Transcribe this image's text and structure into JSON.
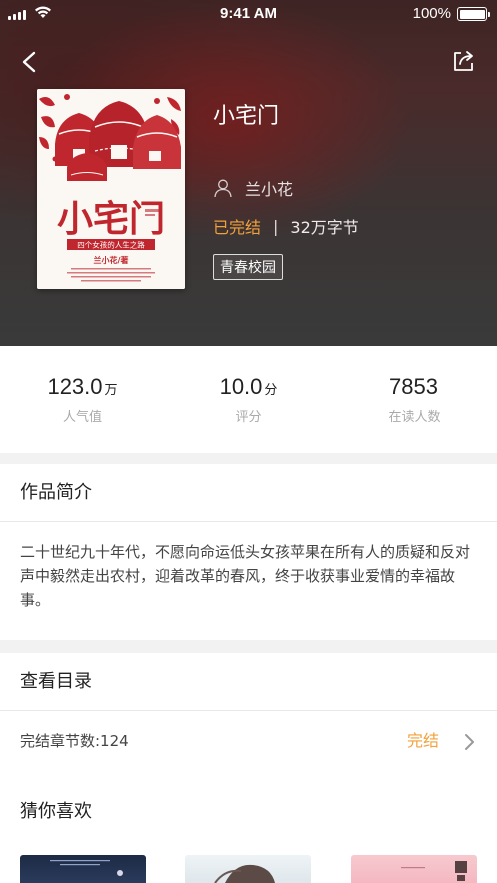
{
  "status_bar": {
    "time": "9:41 AM",
    "battery": "100%"
  },
  "book": {
    "title": "小宅门",
    "author": "兰小花",
    "status": "已完结",
    "separator": "|",
    "word_count": "32万字节",
    "tag": "青春校园",
    "cover": {
      "title": "小宅门",
      "subtitle": "四个女孩的人生之路",
      "author_line": "兰小花/著"
    }
  },
  "stats": [
    {
      "value": "123.0",
      "unit": "万",
      "label": "人气值"
    },
    {
      "value": "10.0",
      "unit": "分",
      "label": "评分"
    },
    {
      "value": "7853",
      "unit": "",
      "label": "在读人数"
    }
  ],
  "intro": {
    "header": "作品简介",
    "text": "二十世纪九十年代，不愿向命运低头女孩苹果在所有人的质疑和反对声中毅然走出农村，迎着改革的春风，终于收获事业爱情的幸福故事。"
  },
  "toc": {
    "header": "查看目录",
    "chapters_label": "完结章节数:124",
    "status": "完结"
  },
  "recommend": {
    "header": "猜你喜欢"
  },
  "icons": {
    "back": "chevron-left-icon",
    "share": "share-icon",
    "author": "person-icon",
    "toc_arrow": "chevron-right-icon"
  },
  "colors": {
    "accent": "#f0a23c",
    "cover_red": "#c0262d"
  }
}
